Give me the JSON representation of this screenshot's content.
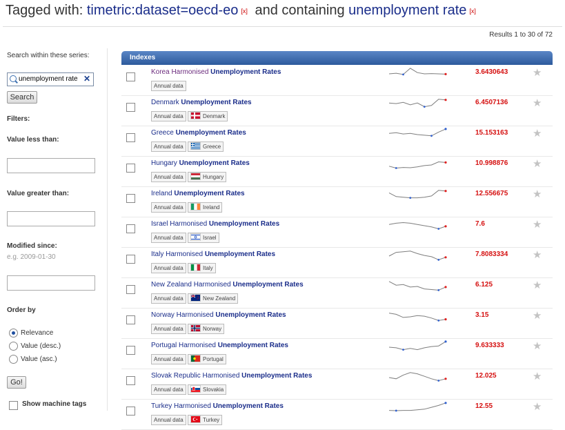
{
  "heading": {
    "prefix": "Tagged with:",
    "tag": "timetric:dataset=oecd-eo",
    "remove": "[x]",
    "middle": "and containing",
    "query": "unemployment rate"
  },
  "results_text": "Results 1 to 30 of 72",
  "sidebar": {
    "search_label": "Search within these series:",
    "search_value": "unemployment rate",
    "search_button": "Search",
    "filters_label": "Filters:",
    "less_label": "Value less than:",
    "greater_label": "Value greater than:",
    "modified_label": "Modified since:",
    "modified_hint": "e.g. 2009-01-30",
    "order_label": "Order by",
    "order_options": [
      "Relevance",
      "Value (desc.)",
      "Value (asc.)"
    ],
    "go_button": "Go!",
    "machine_tags_label": "Show machine tags"
  },
  "panel_title": "Indexes",
  "rows": [
    {
      "prefix": "Korea Harmonised ",
      "bold": "Unemployment Rates",
      "value": "3.6430643",
      "freq": "Annual data",
      "country": "",
      "flag": "",
      "visited": true,
      "spark": [
        0.5,
        0.45,
        0.55,
        0.05,
        0.4,
        0.5,
        0.48,
        0.5,
        0.52
      ],
      "end": "red"
    },
    {
      "prefix": "Denmark ",
      "bold": "Unemployment Rates",
      "value": "6.4507136",
      "freq": "Annual data",
      "country": "Denmark",
      "flag": "dk",
      "visited": false,
      "spark": [
        0.4,
        0.45,
        0.35,
        0.55,
        0.4,
        0.7,
        0.6,
        0.1,
        0.15
      ],
      "end": "red"
    },
    {
      "prefix": "Greece ",
      "bold": "Unemployment Rates",
      "value": "15.153163",
      "freq": "Annual data",
      "country": "Greece",
      "flag": "gr",
      "visited": false,
      "spark": [
        0.4,
        0.35,
        0.45,
        0.4,
        0.5,
        0.55,
        0.6,
        0.3,
        0.05
      ],
      "end": "blue"
    },
    {
      "prefix": "Hungary ",
      "bold": "Unemployment Rates",
      "value": "10.998876",
      "freq": "Annual data",
      "country": "Hungary",
      "flag": "hu",
      "visited": false,
      "spark": [
        0.6,
        0.75,
        0.7,
        0.72,
        0.65,
        0.55,
        0.5,
        0.25,
        0.3
      ],
      "end": "red"
    },
    {
      "prefix": "Ireland ",
      "bold": "Unemployment Rates",
      "value": "12.556675",
      "freq": "Annual data",
      "country": "Ireland",
      "flag": "ie",
      "visited": false,
      "spark": [
        0.3,
        0.6,
        0.65,
        0.7,
        0.7,
        0.65,
        0.55,
        0.1,
        0.15
      ],
      "end": "red"
    },
    {
      "prefix": "Israel Harmonised ",
      "bold": "Unemployment Rates",
      "value": "7.6",
      "freq": "Annual data",
      "country": "Israel",
      "flag": "il",
      "visited": false,
      "spark": [
        0.4,
        0.3,
        0.25,
        0.3,
        0.4,
        0.5,
        0.6,
        0.75,
        0.55
      ],
      "end": "red"
    },
    {
      "prefix": "Italy Harmonised ",
      "bold": "Unemployment Rates",
      "value": "7.8083334",
      "freq": "Annual data",
      "country": "Italy",
      "flag": "it",
      "visited": false,
      "spark": [
        0.5,
        0.2,
        0.15,
        0.1,
        0.3,
        0.45,
        0.55,
        0.8,
        0.6
      ],
      "end": "red"
    },
    {
      "prefix": "New Zealand Harmonised ",
      "bold": "Unemployment Rates",
      "value": "6.125",
      "freq": "Annual data",
      "country": "New Zealand",
      "flag": "nz",
      "visited": false,
      "spark": [
        0.1,
        0.4,
        0.35,
        0.55,
        0.5,
        0.7,
        0.75,
        0.8,
        0.55
      ],
      "end": "red"
    },
    {
      "prefix": "Norway Harmonised ",
      "bold": "Unemployment Rates",
      "value": "3.15",
      "freq": "Annual data",
      "country": "Norway",
      "flag": "no",
      "visited": false,
      "spark": [
        0.2,
        0.3,
        0.55,
        0.5,
        0.4,
        0.45,
        0.6,
        0.8,
        0.7
      ],
      "end": "red"
    },
    {
      "prefix": "Portugal Harmonised ",
      "bold": "Unemployment Rates",
      "value": "9.633333",
      "freq": "Annual data",
      "country": "Portugal",
      "flag": "pt",
      "visited": false,
      "spark": [
        0.5,
        0.55,
        0.7,
        0.6,
        0.7,
        0.55,
        0.45,
        0.4,
        0.05
      ],
      "end": "blue"
    },
    {
      "prefix": "Slovak Republic Harmonised ",
      "bold": "Unemployment Rates",
      "value": "12.025",
      "freq": "Annual data",
      "country": "Slovakia",
      "flag": "sk",
      "visited": false,
      "spark": [
        0.5,
        0.6,
        0.3,
        0.1,
        0.2,
        0.4,
        0.6,
        0.75,
        0.6
      ],
      "end": "red"
    },
    {
      "prefix": "Turkey Harmonised ",
      "bold": "Unemployment Rates",
      "value": "12.55",
      "freq": "Annual data",
      "country": "Turkey",
      "flag": "tr",
      "visited": false,
      "spark": [
        0.7,
        0.72,
        0.7,
        0.7,
        0.65,
        0.6,
        0.45,
        0.3,
        0.1
      ],
      "end": "blue"
    }
  ]
}
